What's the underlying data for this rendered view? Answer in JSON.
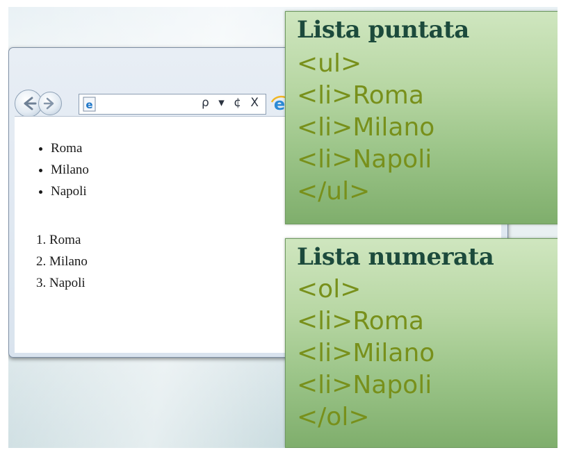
{
  "browser": {
    "address_tools": "ρ ▾ ¢ X",
    "bullet_list": [
      "Roma",
      "Milano",
      "Napoli"
    ],
    "numbered_list": [
      "Roma",
      "Milano",
      "Napoli"
    ]
  },
  "boxes": [
    {
      "title": "Lista puntata",
      "lines": [
        "<ul>",
        "<li>Roma",
        "<li>Milano",
        "<li>Napoli",
        "</ul>"
      ]
    },
    {
      "title": "Lista numerata",
      "lines": [
        "<ol>",
        "<li>Roma",
        "<li>Milano",
        "<li>Napoli",
        "</ol>"
      ]
    }
  ],
  "colors": {
    "box_title": "#1c4a3c",
    "code_text": "#78901b",
    "box_green": "#9cc589"
  }
}
